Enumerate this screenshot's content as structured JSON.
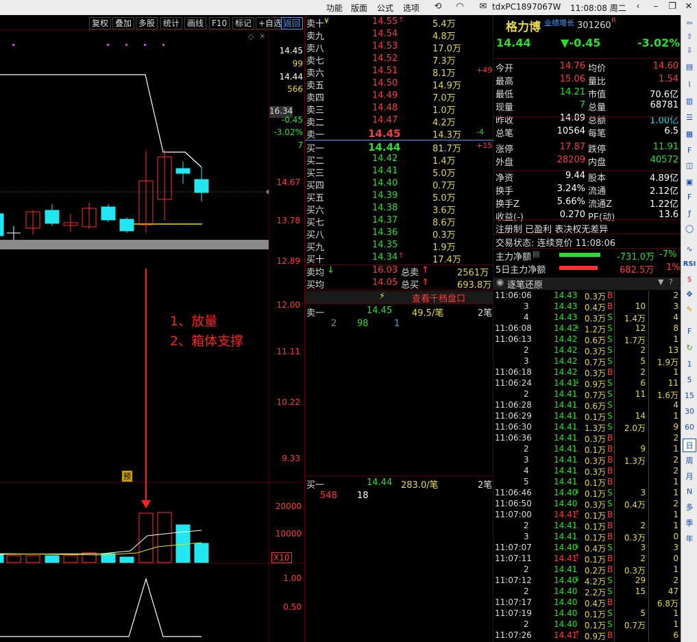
{
  "top_menu": {
    "items": [
      "功能",
      "版面",
      "公式",
      "选项"
    ],
    "user": "tdxPC1897067W",
    "clock": "11:08:08 周二"
  },
  "toolbar": {
    "buttons": [
      "复权",
      "叠加",
      "多股",
      "统计",
      "画线",
      "F10",
      "标记",
      "+自选",
      "返回"
    ]
  },
  "chart": {
    "price_axis": [
      "14.45",
      "14.67",
      "13.78",
      "12.89",
      "12.00",
      "11.11",
      "10.22",
      "9.33"
    ],
    "side_info": {
      "price": "14.45",
      "v1": "99",
      "price2": "14.44",
      "v2": "566",
      "v3": "16.34",
      "change": "-0.45",
      "pct": "-3.02%",
      "v4": "7"
    },
    "volume_axis": [
      "20000",
      "10000",
      "X10"
    ],
    "indicator_axis": [
      "1.00",
      "0.50"
    ],
    "annotation_line1": "1、放量",
    "annotation_line2": "2、箱体支撑",
    "pre_badge": "预",
    "colors": {
      "up": "#ff3030",
      "down": "#22e6f0",
      "ma_white": "#ffffff",
      "ma_yellow": "#e6e600",
      "annotation": "#ff2020"
    }
  },
  "orderbook": {
    "asks": [
      {
        "label": "卖十",
        "mark": "¥",
        "price": "14.55",
        "arrow": "↑",
        "vol": "5.4万",
        "chg": ""
      },
      {
        "label": "卖九",
        "mark": "",
        "price": "14.54",
        "arrow": "",
        "vol": "4.8万",
        "chg": ""
      },
      {
        "label": "卖八",
        "mark": "",
        "price": "14.53",
        "arrow": "",
        "vol": "17.0万",
        "chg": ""
      },
      {
        "label": "卖七",
        "mark": "",
        "price": "14.52",
        "arrow": "",
        "vol": "7.3万",
        "chg": ""
      },
      {
        "label": "卖六",
        "mark": "",
        "price": "14.51",
        "arrow": "",
        "vol": "8.1万",
        "chg": "+49"
      },
      {
        "label": "卖五",
        "mark": "",
        "price": "14.50",
        "arrow": "",
        "vol": "14.9万",
        "chg": ""
      },
      {
        "label": "卖四",
        "mark": "",
        "price": "14.49",
        "arrow": "",
        "vol": "7.0万",
        "chg": ""
      },
      {
        "label": "卖三",
        "mark": "",
        "price": "14.48",
        "arrow": "",
        "vol": "1.0万",
        "chg": ""
      },
      {
        "label": "卖二",
        "mark": "",
        "price": "14.47",
        "arrow": "",
        "vol": "4.2万",
        "chg": ""
      },
      {
        "label": "卖一",
        "mark": "",
        "price": "14.45",
        "arrow": "",
        "vol": "14.3万",
        "chg": "-4"
      }
    ],
    "bids": [
      {
        "label": "买一",
        "price": "14.44",
        "arrow": "",
        "vol": "81.7万",
        "chg": "+15"
      },
      {
        "label": "买二",
        "price": "14.42",
        "arrow": "",
        "vol": "1.4万",
        "chg": ""
      },
      {
        "label": "买三",
        "price": "14.41",
        "arrow": "",
        "vol": "5.0万",
        "chg": ""
      },
      {
        "label": "买四",
        "price": "14.40",
        "arrow": "",
        "vol": "0.7万",
        "chg": ""
      },
      {
        "label": "买五",
        "price": "14.39",
        "arrow": "",
        "vol": "5.0万",
        "chg": ""
      },
      {
        "label": "买六",
        "price": "14.38",
        "arrow": "",
        "vol": "3.6万",
        "chg": ""
      },
      {
        "label": "买七",
        "price": "14.37",
        "arrow": "",
        "vol": "8.6万",
        "chg": ""
      },
      {
        "label": "买八",
        "price": "14.36",
        "arrow": "",
        "vol": "0.3万",
        "chg": ""
      },
      {
        "label": "买九",
        "price": "14.35",
        "arrow": "",
        "vol": "1.9万",
        "chg": ""
      },
      {
        "label": "买十",
        "price": "14.34",
        "arrow": "↑",
        "vol": "17.4万",
        "chg": ""
      }
    ],
    "summary": {
      "sell_avg_label": "卖均",
      "sell_avg": "16.03",
      "total_sell_label": "总卖",
      "total_sell": "2561万",
      "buy_avg_label": "买均",
      "buy_avg": "14.05",
      "total_buy_label": "总买",
      "total_buy": "693.8万"
    },
    "view_link": "查看千档盘口",
    "queue_sell": {
      "label": "卖一",
      "price": "14.45",
      "per": "49.5/笔",
      "count": "2笔",
      "orders": [
        "2",
        "98",
        "1"
      ]
    },
    "queue_buy": {
      "label": "买一",
      "price": "14.44",
      "per": "283.0/笔",
      "count": "2笔",
      "orders": [
        "548",
        "18"
      ]
    }
  },
  "quote": {
    "name": "格力博",
    "tag": "业绩增长",
    "code": "301260",
    "r_badge": "R",
    "price": "14.44",
    "change": "▼-0.45",
    "pct": "-3.02%",
    "stats": [
      {
        "l1": "今开",
        "v1": "14.76",
        "c1": "red",
        "l2": "均价",
        "v2": "14.60",
        "c2": "red"
      },
      {
        "l1": "最高",
        "v1": "15.06",
        "c1": "red",
        "l2": "量比",
        "v2": "1.54",
        "c2": "red"
      },
      {
        "l1": "最低",
        "v1": "14.21",
        "c1": "green",
        "l2": "市值",
        "v2": "70.6亿",
        "c2": "white"
      },
      {
        "l1": "现量",
        "v1": "7",
        "c1": "green",
        "l2": "总量",
        "v2": "68781",
        "c2": "white"
      },
      {
        "l1": "昨收",
        "v1": "14.89",
        "c1": "white",
        "l2": "总额",
        "v2": "1.00亿",
        "c2": "cyan"
      },
      {
        "l1": "总笔",
        "v1": "10564",
        "c1": "white",
        "l2": "每笔",
        "v2": "6.5",
        "c2": "white"
      },
      {
        "l1": "涨停",
        "v1": "17.87",
        "c1": "red",
        "l2": "跌停",
        "v2": "11.91",
        "c2": "green"
      },
      {
        "l1": "外盘",
        "v1": "28209",
        "c1": "red",
        "l2": "内盘",
        "v2": "40572",
        "c2": "green"
      },
      {
        "l1": "净资",
        "v1": "9.44",
        "c1": "white",
        "l2": "股本",
        "v2": "4.89亿",
        "c2": "white"
      },
      {
        "l1": "换手",
        "v1": "3.24%",
        "c1": "white",
        "l2": "流通",
        "v2": "2.12亿",
        "c2": "white"
      },
      {
        "l1": "换手Z",
        "v1": "5.66%",
        "c1": "white",
        "l2": "流通Z",
        "v2": "1.22亿",
        "c2": "white"
      },
      {
        "l1": "收益(-)",
        "v1": "0.270",
        "c1": "white",
        "l2": "PE(动)",
        "v2": "13.6",
        "c2": "white"
      }
    ],
    "register": "注册制 已盈利 表决权无差异",
    "status": "交易状态: 连续竞价 11:08:06",
    "main_flow_label": "主力净额",
    "main_flow": "-731.0万",
    "main_flow_pct": "-7%",
    "flow5_label": "5日主力净额",
    "flow5": "682.5万",
    "flow5_pct": "1%",
    "tick_header": "逐笔还原"
  },
  "ticks": [
    {
      "t": "11:06:06",
      "p": "14.43",
      "a": "",
      "v": "0.3万",
      "s": "B",
      "g": "",
      "k": "2"
    },
    {
      "t": "3",
      "p": "14.43",
      "a": "",
      "v": "0.4万",
      "s": "B",
      "g": "10",
      "k": "3"
    },
    {
      "t": "4",
      "p": "14.43",
      "a": "",
      "v": "0.3万",
      "s": "S",
      "g": "1.4万",
      "k": "4"
    },
    {
      "t": "11:06:08",
      "p": "14.42",
      "a": "↓",
      "v": "1.2万",
      "s": "S",
      "g": "12",
      "k": "8"
    },
    {
      "t": "11:06:13",
      "p": "14.42",
      "a": "",
      "v": "0.6万",
      "s": "S",
      "g": "1.7万",
      "k": "1"
    },
    {
      "t": "2",
      "p": "14.42",
      "a": "",
      "v": "0.3万",
      "s": "S",
      "g": "2",
      "k": "13"
    },
    {
      "t": "3",
      "p": "14.42",
      "a": "",
      "v": "0.7万",
      "s": "S",
      "g": "5",
      "k": "1.9万"
    },
    {
      "t": "11:06:18",
      "p": "14.42",
      "a": "",
      "v": "0.3万",
      "s": "B",
      "g": "2",
      "k": "1"
    },
    {
      "t": "11:06:24",
      "p": "14.41",
      "a": "↓",
      "v": "0.9万",
      "s": "S",
      "g": "6",
      "k": "11"
    },
    {
      "t": "2",
      "p": "14.41",
      "a": "",
      "v": "0.7万",
      "s": "S",
      "g": "11",
      "k": "1.6万"
    },
    {
      "t": "11:06:28",
      "p": "14.41",
      "a": "",
      "v": "0.6万",
      "s": "S",
      "g": "",
      "k": "4"
    },
    {
      "t": "11:06:29",
      "p": "14.41",
      "a": "",
      "v": "0.1万",
      "s": "S",
      "g": "14",
      "k": "1"
    },
    {
      "t": "11:06:30",
      "p": "14.41",
      "a": "",
      "v": "1.3万",
      "s": "S",
      "g": "2.0万",
      "k": "9"
    },
    {
      "t": "11:06:36",
      "p": "14.41",
      "a": "",
      "v": "0.3万",
      "s": "B",
      "g": "",
      "k": "2"
    },
    {
      "t": "2",
      "p": "14.41",
      "a": "",
      "v": "0.1万",
      "s": "B",
      "g": "9",
      "k": "1"
    },
    {
      "t": "3",
      "p": "14.41",
      "a": "",
      "v": "0.3万",
      "s": "B",
      "g": "1.3万",
      "k": "2"
    },
    {
      "t": "4",
      "p": "14.41",
      "a": "",
      "v": "0.3万",
      "s": "B",
      "g": "",
      "k": "2"
    },
    {
      "t": "5",
      "p": "14.41",
      "a": "",
      "v": "0.1万",
      "s": "B",
      "g": "",
      "k": "1"
    },
    {
      "t": "11:06:46",
      "p": "14.40",
      "a": "↓",
      "v": "0.1万",
      "s": "S",
      "g": "3",
      "k": "1"
    },
    {
      "t": "11:06:50",
      "p": "14.40",
      "a": "",
      "v": "0.3万",
      "s": "S",
      "g": "0.4万",
      "k": "2"
    },
    {
      "t": "11:07:00",
      "p": "14.41",
      "a": "↑",
      "v": "0.1万",
      "s": "B",
      "g": "",
      "k": "1"
    },
    {
      "t": "2",
      "p": "14.41",
      "a": "",
      "v": "0.1万",
      "s": "B",
      "g": "2",
      "k": "1"
    },
    {
      "t": "3",
      "p": "14.41",
      "a": "",
      "v": "0.1万",
      "s": "B",
      "g": "0.3万",
      "k": "0"
    },
    {
      "t": "11:07:07",
      "p": "14.40",
      "a": "↓",
      "v": "0.4万",
      "s": "S",
      "g": "3",
      "k": "3"
    },
    {
      "t": "11:07:11",
      "p": "14.41",
      "a": "↑",
      "v": "0.1万",
      "s": "B",
      "g": "2",
      "k": "0"
    },
    {
      "t": "2",
      "p": "14.41",
      "a": "",
      "v": "0.2万",
      "s": "B",
      "g": "0.3万",
      "k": "1"
    },
    {
      "t": "11:07:12",
      "p": "14.40",
      "a": "↓",
      "v": "4.2万",
      "s": "S",
      "g": "29",
      "k": "2"
    },
    {
      "t": "2",
      "p": "14.40",
      "a": "",
      "v": "2.2万",
      "s": "S",
      "g": "15",
      "k": "47"
    },
    {
      "t": "11:07:17",
      "p": "14.40",
      "a": "",
      "v": "0.4万",
      "s": "B",
      "g": "",
      "k": "6.8万"
    },
    {
      "t": "11:07:19",
      "p": "14.40",
      "a": "",
      "v": "0.1万",
      "s": "S",
      "g": "5",
      "k": "1"
    },
    {
      "t": "2",
      "p": "14.40",
      "a": "",
      "v": "0.1万",
      "s": "S",
      "g": "0.7万",
      "k": "1"
    },
    {
      "t": "11:07:26",
      "p": "14.41",
      "a": "↑",
      "v": "0.9万",
      "s": "B",
      "g": "",
      "k": "6"
    }
  ],
  "sidebar": {
    "items": [
      "RSI",
      "1",
      "5",
      "15",
      "30",
      "60",
      "日",
      "周",
      "月",
      "N",
      "多",
      "季",
      "年"
    ]
  }
}
